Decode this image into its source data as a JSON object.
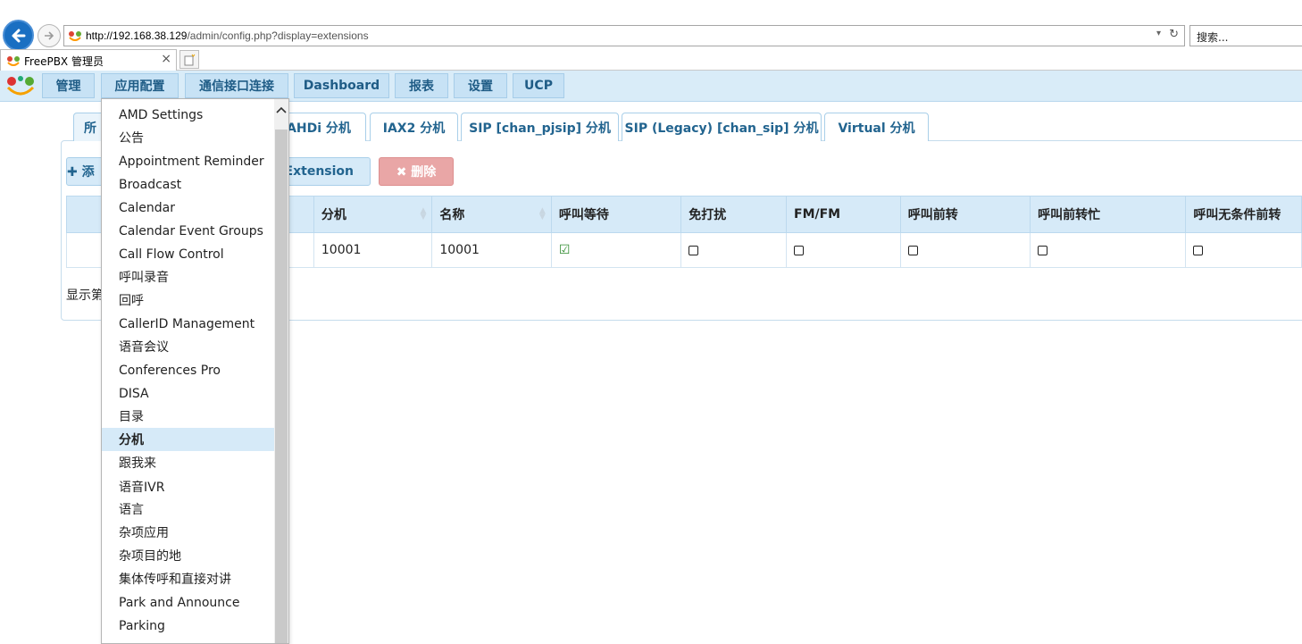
{
  "browser": {
    "url_host": "http://192.168.38.129",
    "url_path": "/admin/config.php?display=extensions",
    "search_placeholder": "搜索...",
    "tab_title": "FreePBX 管理员"
  },
  "nav": {
    "items": [
      "管理",
      "应用配置",
      "通信接口连接",
      "Dashboard",
      "报表",
      "设置",
      "UCP"
    ]
  },
  "page_tabs": [
    "所",
    "AHDi 分机",
    "IAX2 分机",
    "SIP [chan_pjsip] 分机",
    "SIP (Legacy) [chan_sip] 分机",
    "Virtual 分机"
  ],
  "actions": {
    "add_prefix": "✚ 添",
    "add_suffix": "Extension",
    "delete": "✖ 删除"
  },
  "table": {
    "columns": [
      "",
      "分机",
      "名称",
      "呼叫等待",
      "免打扰",
      "FM/FM",
      "呼叫前转",
      "呼叫前转忙",
      "呼叫无条件前转"
    ],
    "rows": [
      {
        "extension": "10001",
        "name": "10001",
        "call_waiting": true,
        "dnd": false,
        "fmfm": false,
        "cf": false,
        "cfb": false,
        "cfu": false
      }
    ],
    "showing_text": "显示第"
  },
  "menu": {
    "items": [
      "AMD Settings",
      "公告",
      "Appointment Reminder",
      "Broadcast",
      "Calendar",
      "Calendar Event Groups",
      "Call Flow Control",
      "呼叫录音",
      "回呼",
      "CallerID Management",
      "语音会议",
      "Conferences Pro",
      "DISA",
      "目录",
      "分机",
      "跟我来",
      "语音IVR",
      "语言",
      "杂项应用",
      "杂项目的地",
      "集体传呼和直接对讲",
      "Park and Announce",
      "Parking"
    ],
    "highlighted": "分机"
  },
  "colors": {
    "nav_bg": "#d9ecf8",
    "accent": "#22648f",
    "delete": "#e9a6a6",
    "check": "#2e8b2e"
  }
}
